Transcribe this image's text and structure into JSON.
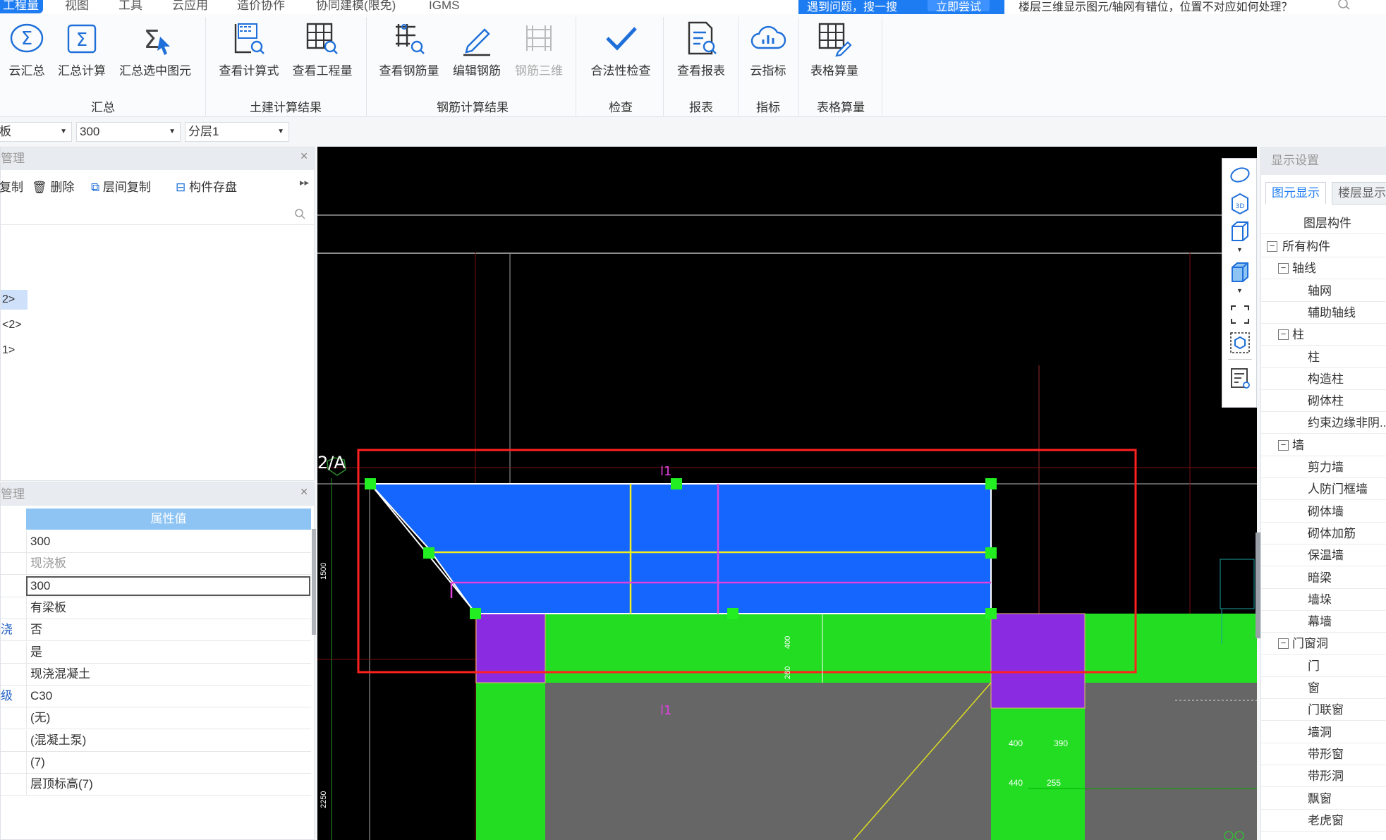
{
  "menu": {
    "items": [
      "工程量",
      "视图",
      "工具",
      "云应用",
      "造价协作",
      "协同建模(限免)",
      "IGMS"
    ],
    "active_index": 0
  },
  "help": {
    "tip": "遇到问题，搜一搜",
    "try_button": "立即尝试",
    "search_text": "楼层三维显示图元/轴网有错位，位置不对应如何处理？"
  },
  "ribbon": {
    "groups": [
      {
        "label": "汇总",
        "buttons": [
          "云汇总",
          "汇总计算",
          "汇总选中图元"
        ]
      },
      {
        "label": "土建计算结果",
        "buttons": [
          "查看计算式",
          "查看工程量"
        ]
      },
      {
        "label": "钢筋计算结果",
        "buttons": [
          "查看钢筋量",
          "编辑钢筋",
          "钢筋三维"
        ]
      },
      {
        "label": "检查",
        "buttons": [
          "合法性检查"
        ]
      },
      {
        "label": "报表",
        "buttons": [
          "查看报表"
        ]
      },
      {
        "label": "指标",
        "buttons": [
          "云指标"
        ]
      },
      {
        "label": "表格算量",
        "buttons": [
          "表格算量"
        ]
      }
    ]
  },
  "selectors": {
    "type": "板",
    "thickness": "300",
    "layer": "分层1"
  },
  "component_panel": {
    "title": "管理",
    "tools": [
      "复制",
      "删除",
      "层间复制",
      "构件存盘"
    ],
    "tree": [
      "2>",
      "<2>",
      "1>"
    ]
  },
  "property_panel": {
    "title": "管理",
    "header": "属性值",
    "rows": [
      {
        "key": "",
        "value": "300"
      },
      {
        "key": "",
        "value": "现浇板"
      },
      {
        "key": "",
        "value": "300"
      },
      {
        "key": "",
        "value": "有梁板"
      },
      {
        "key": "浇",
        "value": "否"
      },
      {
        "key": "",
        "value": "是"
      },
      {
        "key": "",
        "value": "现浇混凝土"
      },
      {
        "key": "级",
        "value": "C30"
      },
      {
        "key": "",
        "value": "(无)"
      },
      {
        "key": "",
        "value": "(混凝土泵)"
      },
      {
        "key": "",
        "value": "(7)"
      },
      {
        "key": "",
        "value": "层顶标高(7)"
      }
    ]
  },
  "canvas": {
    "axis_label": "2/A",
    "labels": {
      "dim_400": "400",
      "dim_390": "390",
      "dim_440": "440",
      "dim_255": "255",
      "dim_1500": "1500",
      "dim_2250": "2250",
      "dim_400v": "400",
      "dim_260": "260"
    },
    "accent": "#1565ff",
    "beam_color": "#22dd22",
    "column_color": "#8a2be2"
  },
  "display_settings": {
    "title": "显示设置",
    "tabs": [
      "图元显示",
      "楼层显示"
    ],
    "header": "图层构件",
    "items": [
      {
        "label": "所有构件",
        "level": 0,
        "expand": "−"
      },
      {
        "label": "轴线",
        "level": 1,
        "expand": "−"
      },
      {
        "label": "轴网",
        "level": 2
      },
      {
        "label": "辅助轴线",
        "level": 2
      },
      {
        "label": "柱",
        "level": 1,
        "expand": "−"
      },
      {
        "label": "柱",
        "level": 2
      },
      {
        "label": "构造柱",
        "level": 2
      },
      {
        "label": "砌体柱",
        "level": 2
      },
      {
        "label": "约束边缘非阴...",
        "level": 2
      },
      {
        "label": "墙",
        "level": 1,
        "expand": "−"
      },
      {
        "label": "剪力墙",
        "level": 2
      },
      {
        "label": "人防门框墙",
        "level": 2
      },
      {
        "label": "砌体墙",
        "level": 2
      },
      {
        "label": "砌体加筋",
        "level": 2
      },
      {
        "label": "保温墙",
        "level": 2
      },
      {
        "label": "暗梁",
        "level": 2
      },
      {
        "label": "墙垛",
        "level": 2
      },
      {
        "label": "幕墙",
        "level": 2
      },
      {
        "label": "门窗洞",
        "level": 1,
        "expand": "−"
      },
      {
        "label": "门",
        "level": 2
      },
      {
        "label": "窗",
        "level": 2
      },
      {
        "label": "门联窗",
        "level": 2
      },
      {
        "label": "墙洞",
        "level": 2
      },
      {
        "label": "带形窗",
        "level": 2
      },
      {
        "label": "带形洞",
        "level": 2
      },
      {
        "label": "飘窗",
        "level": 2
      },
      {
        "label": "老虎窗",
        "level": 2
      }
    ]
  }
}
